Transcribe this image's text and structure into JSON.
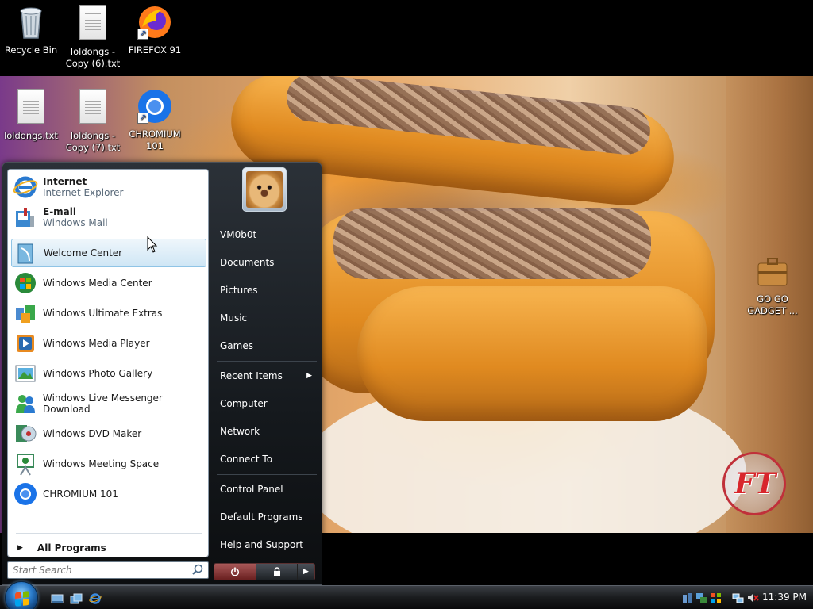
{
  "desktop": {
    "icons": [
      {
        "id": "recycle-bin",
        "label": "Recycle Bin"
      },
      {
        "id": "loldongs-copy6",
        "label": "loldongs - Copy (6).txt"
      },
      {
        "id": "firefox91",
        "label": "FIREFOX 91"
      },
      {
        "id": "loldongs",
        "label": "loldongs.txt"
      },
      {
        "id": "loldongs-copy7",
        "label": "loldongs - Copy (7).txt"
      },
      {
        "id": "chromium101",
        "label": "CHROMIUM 101"
      },
      {
        "id": "go-go-gadget",
        "label": "GO GO GADGET ..."
      }
    ],
    "gadget_logo_text": "FT"
  },
  "start_menu": {
    "pinned": [
      {
        "title": "Internet",
        "subtitle": "Internet Explorer",
        "icon": "internet-explorer-icon"
      },
      {
        "title": "E-mail",
        "subtitle": "Windows Mail",
        "icon": "windows-mail-icon"
      }
    ],
    "recent": [
      {
        "label": "Welcome Center",
        "icon": "welcome-center-icon"
      },
      {
        "label": "Windows Media Center",
        "icon": "media-center-icon"
      },
      {
        "label": "Windows Ultimate Extras",
        "icon": "ultimate-extras-icon"
      },
      {
        "label": "Windows Media Player",
        "icon": "media-player-icon"
      },
      {
        "label": "Windows Photo Gallery",
        "icon": "photo-gallery-icon"
      },
      {
        "label": "Windows Live Messenger Download",
        "icon": "messenger-icon"
      },
      {
        "label": "Windows DVD Maker",
        "icon": "dvd-maker-icon"
      },
      {
        "label": "Windows Meeting Space",
        "icon": "meeting-space-icon"
      },
      {
        "label": "CHROMIUM 101",
        "icon": "chromium-icon"
      }
    ],
    "all_programs": "All Programs",
    "search_placeholder": "Start Search",
    "right_links": [
      {
        "label": "VM0b0t"
      },
      {
        "label": "Documents"
      },
      {
        "label": "Pictures"
      },
      {
        "label": "Music"
      },
      {
        "label": "Games"
      },
      {
        "label": "Recent Items"
      },
      {
        "label": "Computer"
      },
      {
        "label": "Network"
      },
      {
        "label": "Connect To"
      },
      {
        "label": "Control Panel"
      },
      {
        "label": "Default Programs"
      },
      {
        "label": "Help and Support"
      }
    ]
  },
  "taskbar": {
    "clock": "11:39 PM"
  },
  "colors": {
    "start_menu_bg": "#15191d",
    "hover_highlight": "#cfe6f5",
    "power_button": "#a85858"
  }
}
